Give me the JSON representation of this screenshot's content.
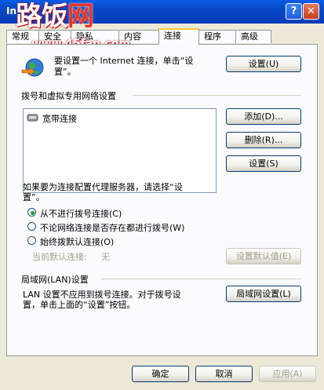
{
  "window": {
    "title": "In"
  },
  "watermark": {
    "logo_part1": "路",
    "logo_part2": "饭",
    "logo_part3": "网",
    "url": "www.45fan.com"
  },
  "tabs": [
    "常规",
    "安全",
    "隐私",
    "内容",
    "连接",
    "程序",
    "高级"
  ],
  "setup": {
    "text_line1": "要设置一个 Internet 连接，单击“设",
    "text_line2": "置”。",
    "button": "设置(U)"
  },
  "dialup": {
    "group_title": "拨号和虚拟专用网络设置",
    "items": [
      "宽带连接"
    ],
    "add_button": "添加(D)...",
    "remove_button": "删除(R)...",
    "settings_button": "设置(S)"
  },
  "proxy_hint": {
    "line1": "如果要为连接配置代理服务器，请选择“设",
    "line2": "置”。"
  },
  "options": [
    {
      "label": "从不进行拨号连接(C)",
      "selected": true
    },
    {
      "label": "不论网络连接是否存在都进行拨号(W)",
      "selected": false
    },
    {
      "label": "始终拨默认连接(O)",
      "selected": false
    }
  ],
  "default_connection": {
    "label": "当前默认连接:",
    "value": "无",
    "button": "设置默认值(E)"
  },
  "lan": {
    "group_title": "局域网(LAN)设置",
    "text_line1": "LAN 设置不应用到拨号连接。对于拨号设",
    "text_line2": "置，单击上面的“设置”按钮。",
    "button": "局域网设置(L)"
  },
  "footer": {
    "ok": "确定",
    "cancel": "取消",
    "apply": "应用(A)"
  }
}
